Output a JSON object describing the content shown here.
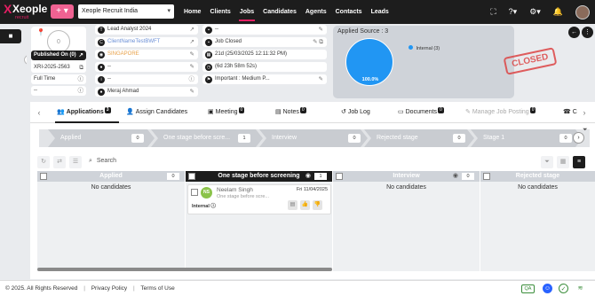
{
  "topnav": {
    "logo_text": "Xeople",
    "logo_sub": "recruit",
    "add_label": "+ ▾",
    "company": "Xeople Recruit India",
    "links": [
      "Home",
      "Clients",
      "Jobs",
      "Candidates",
      "Agents",
      "Contacts",
      "Leads"
    ],
    "active_link": "Jobs"
  },
  "job": {
    "published": "Published On (0)",
    "code": "XRI-2025-2563",
    "employment": "Full Time",
    "misc": "--",
    "title": "Lead Analyst 2024",
    "client": "ClientNameTestBWFT",
    "location": "SINGAPORE",
    "blank1": "--",
    "blank2": "--",
    "owner": "Meraj Ahmad",
    "status_blank": "--",
    "status": "Job Closed",
    "created": "21d (25/03/2025 12:11:32 PM)",
    "duration": "(6d 23h 58m 52s)",
    "priority": "Important",
    "priority_level": "Medium P..."
  },
  "applied_source": {
    "title": "Applied Source : 3",
    "legend": "Internal (3)",
    "pie_label": "100.0%"
  },
  "stamp": "CLOSED",
  "tabs": [
    {
      "label": "Applications",
      "badge": "3"
    },
    {
      "label": "Assign Candidates",
      "badge": ""
    },
    {
      "label": "Meeting",
      "badge": "0"
    },
    {
      "label": "Notes",
      "badge": "0"
    },
    {
      "label": "Job Log",
      "badge": ""
    },
    {
      "label": "Documents",
      "badge": "0"
    },
    {
      "label": "Manage Job Posting",
      "badge": "0"
    },
    {
      "label": "C",
      "badge": ""
    }
  ],
  "stages": [
    {
      "label": "Applied",
      "count": "0"
    },
    {
      "label": "One stage before scre...",
      "count": "1"
    },
    {
      "label": "Interview",
      "count": "0"
    },
    {
      "label": "Rejected stage",
      "count": "0"
    },
    {
      "label": "Stage 1",
      "count": "0"
    }
  ],
  "search_placeholder": "Search",
  "columns": [
    {
      "label": "Applied",
      "count": "0",
      "empty": "No candidates"
    },
    {
      "label": "One stage before screening",
      "count": "1",
      "empty": ""
    },
    {
      "label": "Interview",
      "count": "0",
      "empty": "No candidates"
    },
    {
      "label": "Rejected stage",
      "count": "",
      "empty": "No candidates"
    }
  ],
  "candidate": {
    "initials": "NS",
    "name": "Neelam Singh",
    "role": "One stage before scre...",
    "date": "Fri 11/04/2025",
    "source": "Internal"
  },
  "footer": {
    "copyright": "© 2025. All Rights Reserved",
    "privacy": "Privacy Policy",
    "terms": "Terms of Use",
    "qa": "QA"
  }
}
